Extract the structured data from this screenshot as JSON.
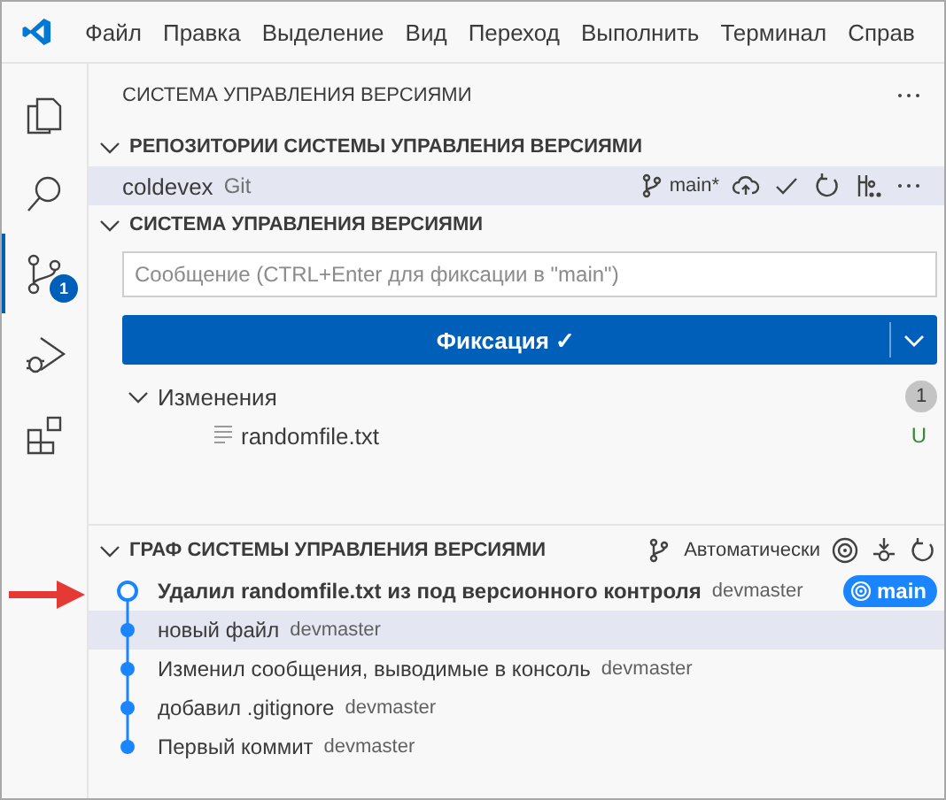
{
  "menu": [
    "Файл",
    "Правка",
    "Выделение",
    "Вид",
    "Переход",
    "Выполнить",
    "Терминал",
    "Справ"
  ],
  "activity_bar": [
    {
      "kind": "explorer",
      "selected": false
    },
    {
      "kind": "search",
      "selected": false
    },
    {
      "kind": "scm",
      "selected": true,
      "badge": "1"
    },
    {
      "kind": "debug",
      "selected": false
    },
    {
      "kind": "extensions",
      "selected": false
    }
  ],
  "panel_title": "СИСТЕМА УПРАВЛЕНИЯ ВЕРСИЯМИ",
  "repositories": {
    "title": "РЕПОЗИТОРИИ СИСТЕМЫ УПРАВЛЕНИЯ ВЕРСИЯМИ",
    "expanded": true,
    "items": [
      {
        "name": "coldevex",
        "provider": "Git",
        "branch": "main*",
        "selected": true
      }
    ]
  },
  "scm": {
    "title": "СИСТЕМА УПРАВЛЕНИЯ ВЕРСИЯМИ",
    "expanded": true,
    "message_placeholder": "Сообщение (CTRL+Enter для фиксации в \"main\")",
    "commit_button": "Фиксация ✓",
    "changes": {
      "label": "Изменения",
      "expanded": true,
      "count": "1",
      "files": [
        {
          "name": "randomfile.txt",
          "status": "U"
        }
      ]
    }
  },
  "graph": {
    "title": "ГРАФ СИСТЕМЫ УПРАВЛЕНИЯ ВЕРСИЯМИ",
    "expanded": true,
    "mode": "Автоматически",
    "commits": [
      {
        "message": "Удалил randomfile.txt из под версионного контроля",
        "author": "devmaster",
        "head": true,
        "selected": false,
        "ref": "main"
      },
      {
        "message": "новый файл",
        "author": "devmaster",
        "head": false,
        "selected": true
      },
      {
        "message": "Изменил сообщения, выводимые в консоль",
        "author": "devmaster",
        "head": false,
        "selected": false
      },
      {
        "message": "добавил .gitignore",
        "author": "devmaster",
        "head": false,
        "selected": false
      },
      {
        "message": "Первый коммит",
        "author": "devmaster",
        "head": false,
        "selected": false
      }
    ]
  }
}
